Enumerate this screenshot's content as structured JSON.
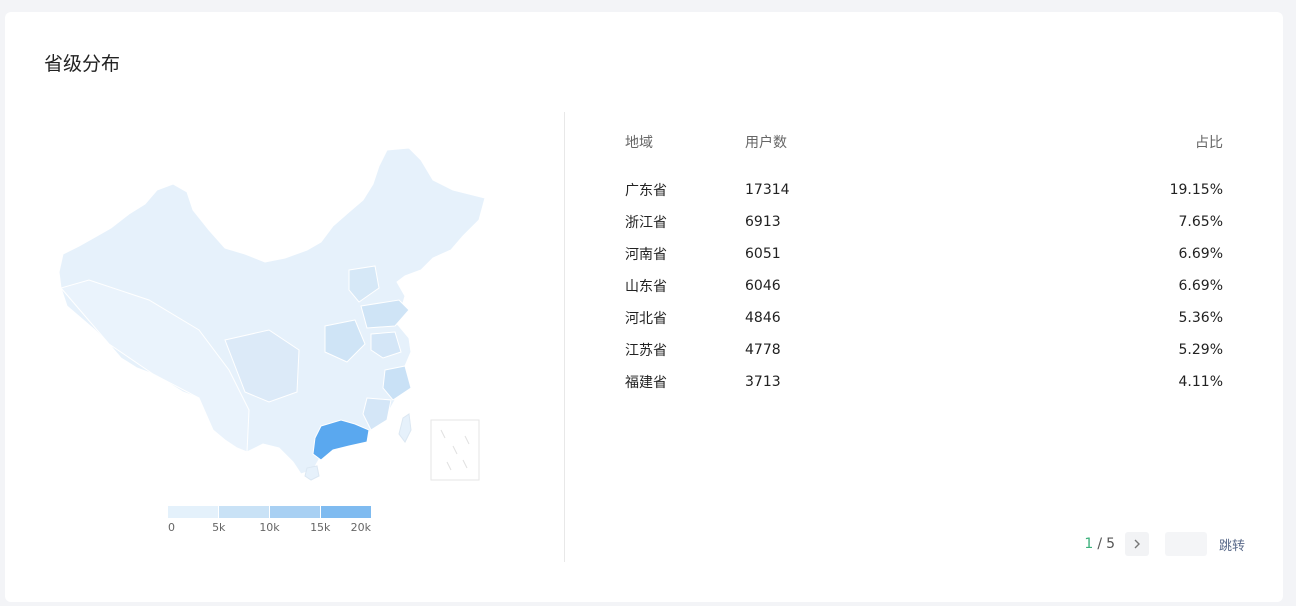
{
  "section": {
    "title": "省级分布"
  },
  "map": {
    "highlight_color": "#5aa8ef",
    "base_color": "#e6f1fb",
    "mid_color": "#cde3f6",
    "highlighted_region": "广东省"
  },
  "legend": {
    "ticks": [
      "0",
      "5k",
      "10k",
      "15k",
      "20k"
    ],
    "range": [
      0,
      20000
    ],
    "colors": [
      "#e4f1fb",
      "#c9e2f6",
      "#a8d0f3",
      "#7fbbf0"
    ]
  },
  "table": {
    "headers": {
      "region": "地域",
      "users": "用户数",
      "ratio": "占比"
    },
    "rows": [
      {
        "region": "广东省",
        "users": "17314",
        "ratio": "19.15%"
      },
      {
        "region": "浙江省",
        "users": "6913",
        "ratio": "7.65%"
      },
      {
        "region": "河南省",
        "users": "6051",
        "ratio": "6.69%"
      },
      {
        "region": "山东省",
        "users": "6046",
        "ratio": "6.69%"
      },
      {
        "region": "河北省",
        "users": "4846",
        "ratio": "5.36%"
      },
      {
        "region": "江苏省",
        "users": "4778",
        "ratio": "5.29%"
      },
      {
        "region": "福建省",
        "users": "3713",
        "ratio": "4.11%"
      }
    ]
  },
  "pagination": {
    "current": "1",
    "separator": "/",
    "total": "5",
    "next_icon": "chevron-right-icon",
    "jump_label": "跳转",
    "jump_value": ""
  }
}
